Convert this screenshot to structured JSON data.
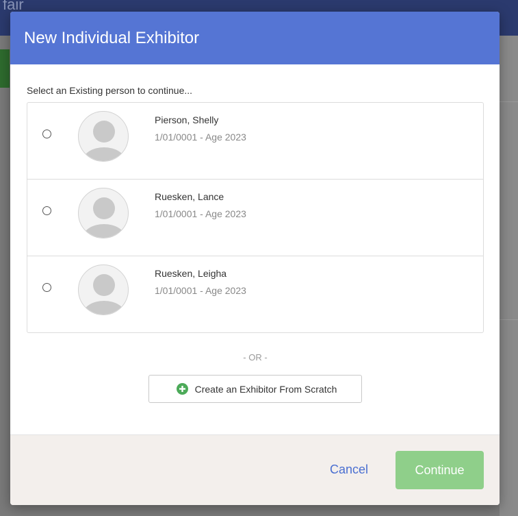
{
  "modal": {
    "title": "New Individual Exhibitor",
    "prompt": "Select an Existing person to continue...",
    "people": [
      {
        "name": "Pierson, Shelly",
        "meta": "1/01/0001 - Age 2023"
      },
      {
        "name": "Ruesken, Lance",
        "meta": "1/01/0001 - Age 2023"
      },
      {
        "name": "Ruesken, Leigha",
        "meta": "1/01/0001 - Age 2023"
      }
    ],
    "or_text": "- OR -",
    "create_button_label": "Create an Exhibitor From Scratch",
    "cancel_label": "Cancel",
    "continue_label": "Continue"
  },
  "background": {
    "title_fragment": "fair"
  },
  "colors": {
    "header": "#5575d4",
    "continue_disabled": "#8fcf8a",
    "link": "#4a6fd1",
    "footer": "#f3efec",
    "plus_icon": "#4caa59"
  }
}
